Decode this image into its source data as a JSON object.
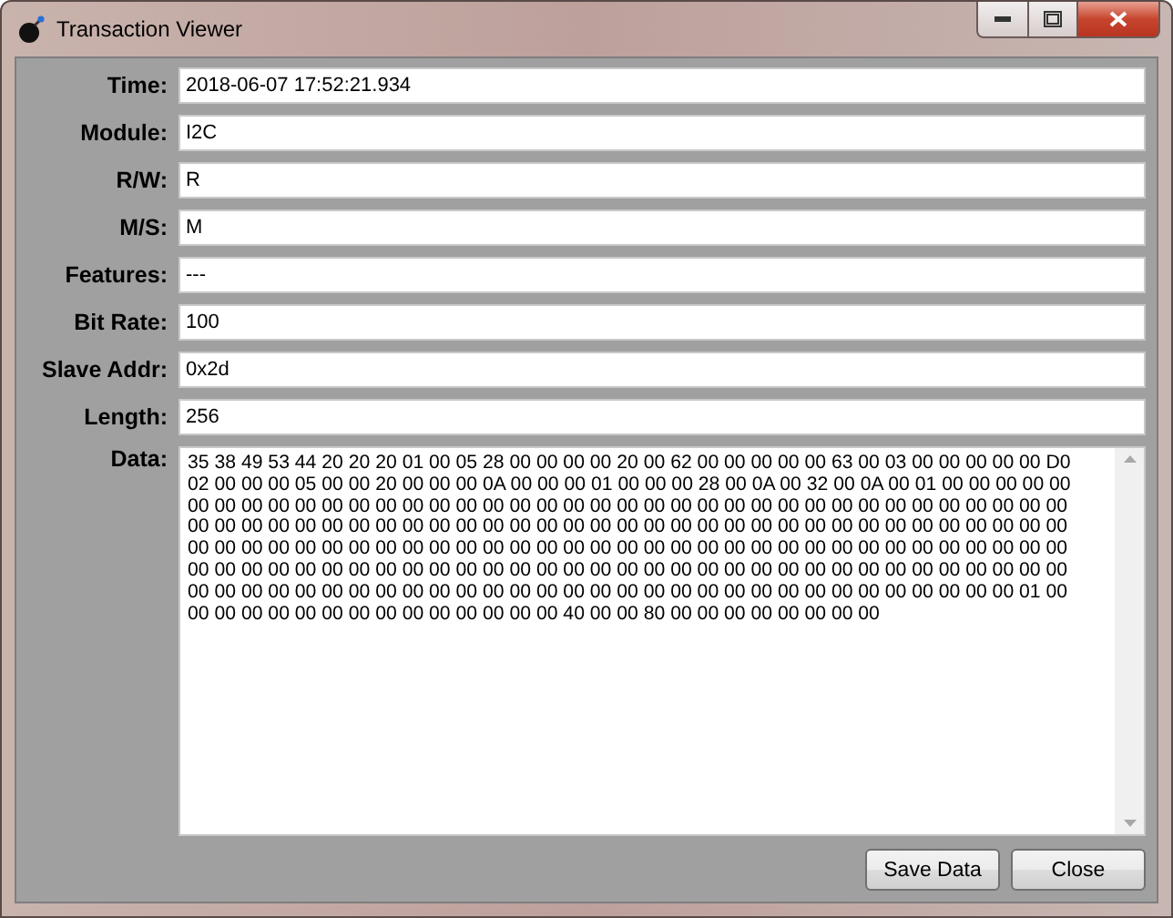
{
  "window": {
    "title": "Transaction Viewer"
  },
  "fields": [
    {
      "label": "Time:",
      "value": "2018-06-07 17:52:21.934"
    },
    {
      "label": "Module:",
      "value": "I2C"
    },
    {
      "label": "R/W:",
      "value": "R"
    },
    {
      "label": "M/S:",
      "value": "M"
    },
    {
      "label": "Features:",
      "value": "---"
    },
    {
      "label": "Bit Rate:",
      "value": "100"
    },
    {
      "label": "Slave Addr:",
      "value": "0x2d"
    },
    {
      "label": "Length:",
      "value": "256"
    }
  ],
  "data": {
    "label": "Data:",
    "lines": [
      "35 38 49 53 44 20 20 20 01 00 05 28 00 00 00 00 20 00 62 00 00 00 00 00 63 00 03 00 00 00 00 00 D0",
      "02 00 00 00 05 00 00 20 00 00 00 0A 00 00 00 01 00 00 00 28 00 0A 00 32 00 0A 00 01 00 00 00 00 00",
      "00 00 00 00 00 00 00 00 00 00 00 00 00 00 00 00 00 00 00 00 00 00 00 00 00 00 00 00 00 00 00 00 00",
      "00 00 00 00 00 00 00 00 00 00 00 00 00 00 00 00 00 00 00 00 00 00 00 00 00 00 00 00 00 00 00 00 00",
      "00 00 00 00 00 00 00 00 00 00 00 00 00 00 00 00 00 00 00 00 00 00 00 00 00 00 00 00 00 00 00 00 00",
      "00 00 00 00 00 00 00 00 00 00 00 00 00 00 00 00 00 00 00 00 00 00 00 00 00 00 00 00 00 00 00 00 00",
      "00 00 00 00 00 00 00 00 00 00 00 00 00 00 00 00 00 00 00 00 00 00 00 00 00 00 00 00 00 00 00 01 00",
      "00 00 00 00 00 00 00 00 00 00 00 00 00 00 40 00 00 80 00 00 00 00 00 00 00 00"
    ]
  },
  "buttons": [
    "Save Data",
    "Close"
  ]
}
